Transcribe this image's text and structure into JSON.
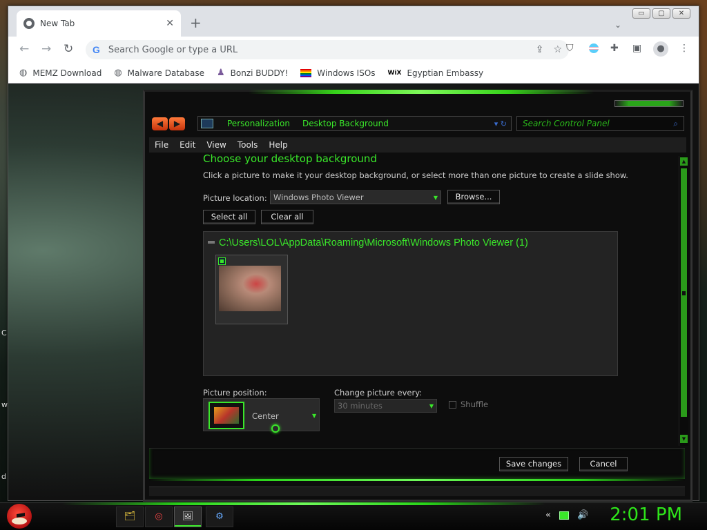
{
  "desktop": {
    "fragments": [
      "C",
      "w",
      "d"
    ]
  },
  "window_controls": {
    "minimize": "▭",
    "maximize": "▢",
    "close": "✕"
  },
  "browser": {
    "tab": {
      "title": "New Tab",
      "close": "✕"
    },
    "new_tab": "+",
    "tab_menu": "⌄",
    "nav": {
      "back": "←",
      "forward": "→",
      "reload": "↻"
    },
    "omnibox": {
      "placeholder": "Search Google or type a URL",
      "google_glyph": "G",
      "share": "⇪",
      "star": "☆"
    },
    "extensions": [
      "ublock",
      "pride-flag",
      "puzzle",
      "side-panel"
    ],
    "profile_glyph": "●",
    "menu_glyph": "⋮",
    "bookmarks": [
      {
        "label": "MEMZ Download",
        "icon": "globe-icon"
      },
      {
        "label": "Malware Database",
        "icon": "globe-icon"
      },
      {
        "label": "Bonzi BUDDY!",
        "icon": "bonzi-icon"
      },
      {
        "label": "Windows ISOs",
        "icon": "rainbow-flag-icon"
      },
      {
        "label": "Egyptian Embassy",
        "icon": "wix-icon"
      }
    ],
    "bookmark_wix": "WiX"
  },
  "control_panel": {
    "nav_back": "◀",
    "nav_forward": "▶",
    "breadcrumb": [
      "Personalization",
      "Desktop Background"
    ],
    "address_tail": "▾ ↻",
    "search_placeholder": "Search Control Panel",
    "search_glyph": "⌕",
    "menu": [
      "File",
      "Edit",
      "View",
      "Tools",
      "Help"
    ],
    "heading": "Choose your desktop background",
    "description": "Click a picture to make it your desktop background, or select more than one picture to create a slide show.",
    "picture_location_label": "Picture location:",
    "picture_location_value": "Windows Photo Viewer",
    "browse_button": "Browse...",
    "select_all_button": "Select all",
    "clear_all_button": "Clear all",
    "group_path": "C:\\Users\\LOL\\AppData\\Roaming\\Microsoft\\Windows Photo Viewer (1)",
    "picture_position_label": "Picture position:",
    "picture_position_value": "Center",
    "change_every_label": "Change picture every:",
    "change_every_value": "30 minutes",
    "shuffle_label": "Shuffle",
    "save_button": "Save changes",
    "cancel_button": "Cancel",
    "dropdown_arrow": "▼"
  },
  "taskbar": {
    "clock": "2:01 PM",
    "items": [
      "explorer",
      "chrome",
      "paint",
      "network"
    ],
    "item_glyphs": [
      "🗂",
      "◎",
      "🖼",
      "⚙"
    ],
    "tray_glyphs": [
      "«",
      "🔊"
    ]
  },
  "colors": {
    "accent_green": "#3ae72a",
    "nav_orange": "#e8501a",
    "chrome_bar": "#dee1e6"
  }
}
